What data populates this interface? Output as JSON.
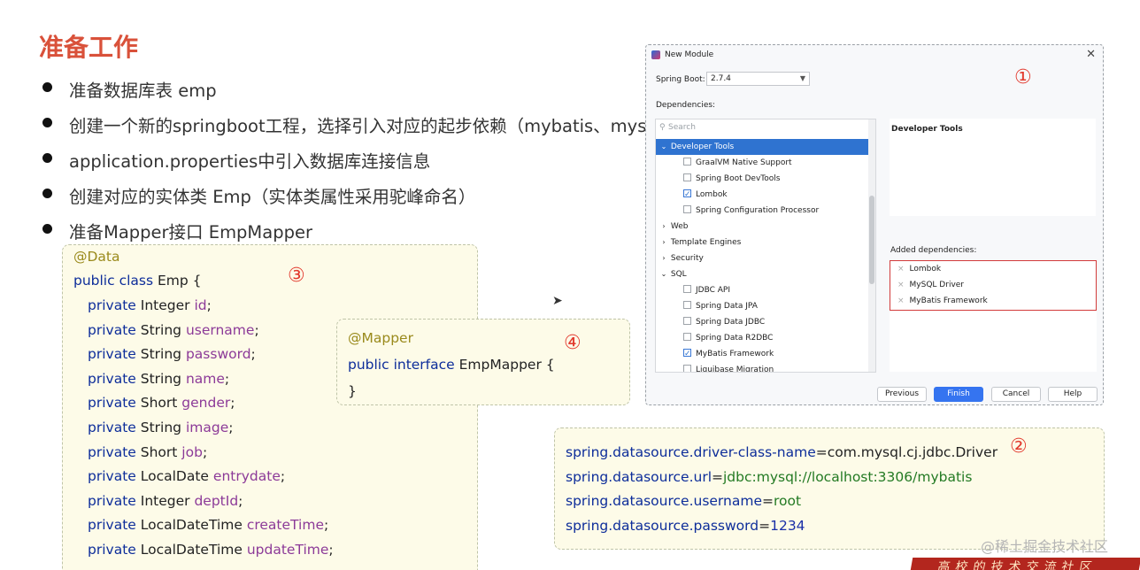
{
  "page": {
    "title": "准备工作",
    "bullets": [
      "准备数据库表 emp",
      "创建一个新的springboot工程，选择引入对应的起步依赖（mybatis、mysql驱动、lombok）",
      "application.properties中引入数据库连接信息",
      "创建对应的实体类 Emp（实体类属性采用驼峰命名）",
      "准备Mapper接口 EmpMapper"
    ]
  },
  "entity_code": {
    "annotation": "@Data",
    "class_kw": "public class",
    "class_name": "Emp {",
    "fields": [
      {
        "kw": "private",
        "type": "Integer",
        "name": "id"
      },
      {
        "kw": "private",
        "type": "String",
        "name": "username"
      },
      {
        "kw": "private",
        "type": "String",
        "name": "password"
      },
      {
        "kw": "private",
        "type": "String",
        "name": "name"
      },
      {
        "kw": "private",
        "type": "Short",
        "name": "gender"
      },
      {
        "kw": "private",
        "type": "String",
        "name": "image"
      },
      {
        "kw": "private",
        "type": "Short",
        "name": "job"
      },
      {
        "kw": "private",
        "type": "LocalDate",
        "name": "entrydate"
      },
      {
        "kw": "private",
        "type": "Integer",
        "name": "deptId"
      },
      {
        "kw": "private",
        "type": "LocalDateTime",
        "name": "createTime"
      },
      {
        "kw": "private",
        "type": "LocalDateTime",
        "name": "updateTime"
      }
    ],
    "semicolon": ";",
    "marker": "③"
  },
  "mapper_code": {
    "annotation": "@Mapper",
    "decl_kw": "public interface",
    "name": "EmpMapper {",
    "close": "}",
    "marker": "④"
  },
  "properties_code": {
    "lines": [
      {
        "key": "spring.datasource.driver-class-name",
        "eq": "=",
        "value": "com.mysql.cj.jdbc.Driver",
        "kind": "plain"
      },
      {
        "key": "spring.datasource.url",
        "eq": "=",
        "value": "jdbc:mysql://localhost:3306/mybatis",
        "kind": "str"
      },
      {
        "key": "spring.datasource.username",
        "eq": "=",
        "value": "root",
        "kind": "str"
      },
      {
        "key": "spring.datasource.password",
        "eq": "=",
        "value": "1234",
        "kind": "num"
      }
    ],
    "marker": "②"
  },
  "dialog": {
    "title": "New Module",
    "close_glyph": "✕",
    "spring_boot_label": "Spring Boot:",
    "spring_boot_version": "2.7.4",
    "dependencies_label": "Dependencies:",
    "search_placeholder": "Search",
    "marker": "①",
    "tree": [
      {
        "label": "Developer Tools",
        "level": 0,
        "expanded": true,
        "selected": true
      },
      {
        "label": "GraalVM Native Support",
        "level": 1,
        "checked": false
      },
      {
        "label": "Spring Boot DevTools",
        "level": 1,
        "checked": false
      },
      {
        "label": "Lombok",
        "level": 1,
        "checked": true
      },
      {
        "label": "Spring Configuration Processor",
        "level": 1,
        "checked": false
      },
      {
        "label": "Web",
        "level": 0,
        "expanded": false
      },
      {
        "label": "Template Engines",
        "level": 0,
        "expanded": false
      },
      {
        "label": "Security",
        "level": 0,
        "expanded": false
      },
      {
        "label": "SQL",
        "level": 0,
        "expanded": true
      },
      {
        "label": "JDBC API",
        "level": 1,
        "checked": false
      },
      {
        "label": "Spring Data JPA",
        "level": 1,
        "checked": false
      },
      {
        "label": "Spring Data JDBC",
        "level": 1,
        "checked": false
      },
      {
        "label": "Spring Data R2DBC",
        "level": 1,
        "checked": false
      },
      {
        "label": "MyBatis Framework",
        "level": 1,
        "checked": true
      },
      {
        "label": "Liquibase Migration",
        "level": 1,
        "checked": false
      }
    ],
    "description_title": "Developer Tools",
    "added_label": "Added dependencies:",
    "added": [
      "Lombok",
      "MySQL Driver",
      "MyBatis Framework"
    ],
    "buttons": {
      "previous": "Previous",
      "finish": "Finish",
      "cancel": "Cancel",
      "help": "Help"
    }
  },
  "watermark": "@稀土掘金技术社区",
  "banner_text": "高校的技术交流社区",
  "colors": {
    "title": "#d9513a",
    "marker": "#e23a2e",
    "keyword": "#0d2d9a",
    "annotation": "#9a8a1c",
    "field": "#8c3a98",
    "string": "#237a23",
    "accent": "#3574f0"
  }
}
